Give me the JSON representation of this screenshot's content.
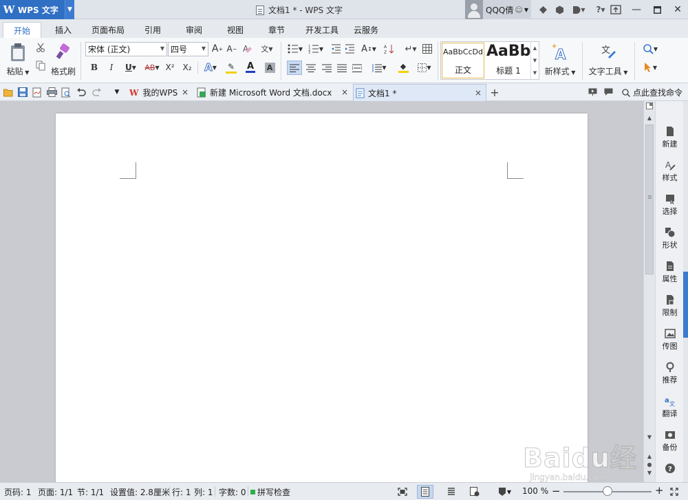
{
  "app": {
    "name": "WPS 文字",
    "window_title": "文档1 * - WPS 文字",
    "user": "QQQ倩"
  },
  "ribbon_tabs": [
    "开始",
    "插入",
    "页面布局",
    "引用",
    "审阅",
    "视图",
    "章节",
    "开发工具",
    "云服务"
  ],
  "active_tab": "开始",
  "home": {
    "paste_label": "粘贴",
    "format_painter_label": "格式刷",
    "font_name": "宋体 (正文)",
    "font_size": "四号",
    "styles": [
      {
        "preview": "AaBbCcDd",
        "label": "正文"
      },
      {
        "preview": "AaBb",
        "label": "标题 1"
      }
    ],
    "new_style_label": "新样式",
    "text_tools_label": "文字工具",
    "bold": "B",
    "italic": "I",
    "underline": "U",
    "strike": "AB",
    "superscript": "X²",
    "subscript": "X₂"
  },
  "doc_tabs": [
    {
      "title": "我的WPS",
      "active": false
    },
    {
      "title": "新建 Microsoft Word 文档.docx",
      "active": false
    },
    {
      "title": "文档1 *",
      "active": true
    }
  ],
  "search_command": "点此查找命令",
  "task_pane": [
    "新建",
    "样式",
    "选择",
    "形状",
    "属性",
    "限制",
    "传图",
    "推荐",
    "翻译",
    "备份"
  ],
  "status": {
    "page_num": "页码: 1",
    "pages": "页面: 1/1",
    "section": "节: 1/1",
    "setting": "设置值: 2.8厘米",
    "row": "行: 1",
    "col": "列: 1",
    "word_count": "字数: 0",
    "spell_check": "拼写检查",
    "zoom": "100 %"
  },
  "watermark": {
    "brand": "Baidu经验",
    "url": "jingyan.baidu.com"
  },
  "colors": {
    "accent": "#2f6fc4",
    "font_color_bar": "#1f3fbf",
    "highlight_bar": "#f2d100",
    "spell_ok": "#2fae4a"
  }
}
